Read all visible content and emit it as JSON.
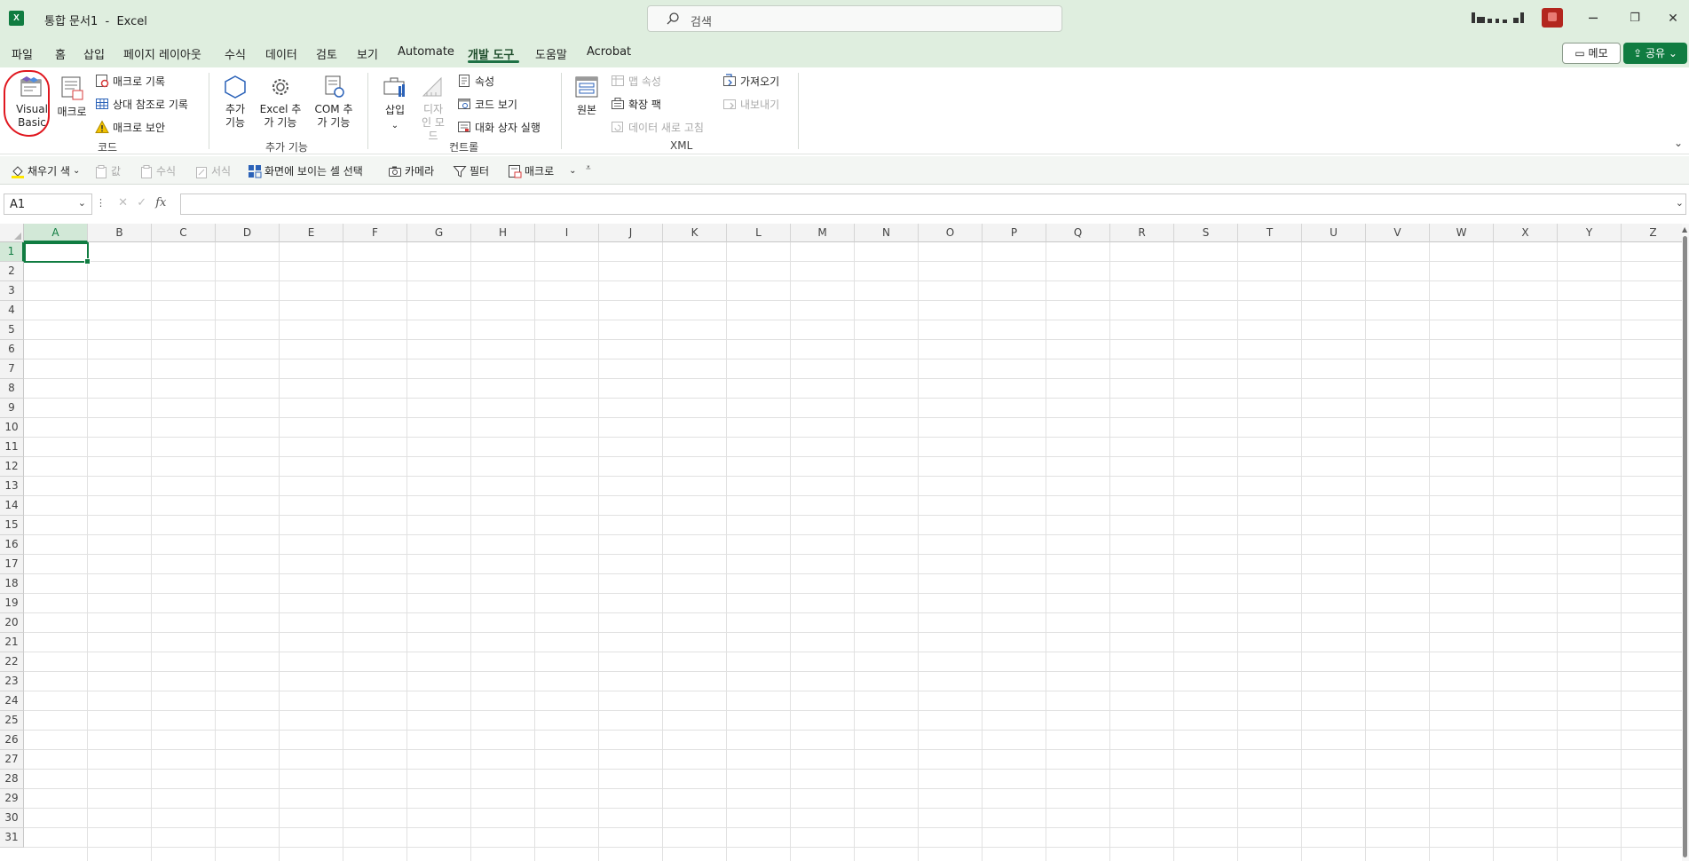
{
  "window": {
    "title": "통합 문서1  -  Excel",
    "search_placeholder": "검색",
    "minimize": "─",
    "restore": "❐",
    "close": "✕"
  },
  "menu": {
    "tabs": [
      "파일",
      "홈",
      "삽입",
      "페이지 레이아웃",
      "수식",
      "데이터",
      "검토",
      "보기",
      "Automate",
      "개발 도구",
      "도움말",
      "Acrobat"
    ],
    "active_tab": "개발 도구",
    "memo_label": "메모",
    "share_label": "공유"
  },
  "ribbon": {
    "code": {
      "visual_basic": "Visual Basic",
      "macro": "매크로",
      "record_macro": "매크로 기록",
      "relative_ref": "상대 참조로 기록",
      "macro_security": "매크로 보안",
      "group_label": "코드"
    },
    "addins": {
      "addins": "추가 기능",
      "excel_addins": "Excel 추가 기능",
      "com_addins": "COM 추가 기능",
      "group_label": "추가 기능"
    },
    "controls": {
      "insert": "삽입",
      "design_mode": "디자인 모드",
      "properties": "속성",
      "view_code": "코드 보기",
      "run_dialog": "대화 상자 실행",
      "group_label": "컨트롤"
    },
    "xml": {
      "source": "원본",
      "map_properties": "맵 속성",
      "expansion_packs": "확장 팩",
      "refresh_data": "데이터 새로 고침",
      "import": "가져오기",
      "export": "내보내기",
      "group_label": "XML"
    }
  },
  "quick_access": {
    "fill_color": "채우기 색",
    "values": "값",
    "formulas": "수식",
    "formatting": "서식",
    "select_visible": "화면에 보이는 셀 선택",
    "camera": "카메라",
    "filter": "필터",
    "macro": "매크로"
  },
  "formula_bar": {
    "name_box": "A1",
    "fx": "fx",
    "value": ""
  },
  "sheet": {
    "columns": [
      "A",
      "B",
      "C",
      "D",
      "E",
      "F",
      "G",
      "H",
      "I",
      "J",
      "K",
      "L",
      "M",
      "N",
      "O",
      "P",
      "Q",
      "R",
      "S",
      "T",
      "U",
      "V",
      "W",
      "X",
      "Y",
      "Z"
    ],
    "rows": [
      "1",
      "2",
      "3",
      "4",
      "5",
      "6",
      "7",
      "8",
      "9",
      "10",
      "11",
      "12",
      "13",
      "14",
      "15",
      "16",
      "17",
      "18",
      "19",
      "20",
      "21",
      "22",
      "23",
      "24",
      "25",
      "26",
      "27",
      "28",
      "29",
      "30",
      "31"
    ],
    "active_cell": "A1",
    "accent_color": "#107c41"
  }
}
